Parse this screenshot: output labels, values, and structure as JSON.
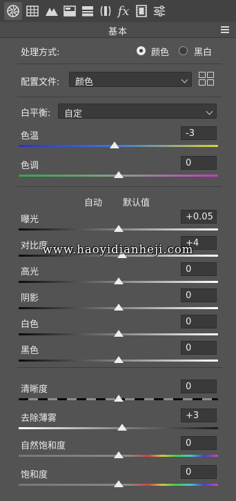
{
  "panel": {
    "title": "基本",
    "treatment_label": "处理方式:",
    "treatment_options": [
      "颜色",
      "黑白"
    ],
    "treatment_selected": "颜色",
    "profile_label": "配置文件:",
    "profile_value": "颜色",
    "white_balance_label": "白平衡:",
    "white_balance_value": "自定",
    "auto_label": "自动",
    "default_label": "默认值"
  },
  "toolbar": {
    "tools": [
      "basic-tool-icon",
      "tone-curve-grid-icon",
      "detail-mountain-icon",
      "hsl-split-icon",
      "split-toning-icon",
      "lens-corrections-icon",
      "fx-icon",
      "calibration-film-icon",
      "presets-sliders-icon"
    ],
    "fx_glyph": "fx"
  },
  "sliders": [
    {
      "label": "色温",
      "value": "-3",
      "position": 0.48
    },
    {
      "label": "色调",
      "value": "0",
      "position": 0.5
    },
    {
      "label": "曝光",
      "value": "+0.05",
      "position": 0.5
    },
    {
      "label": "对比度",
      "value": "+4",
      "position": 0.52
    },
    {
      "label": "高光",
      "value": "0",
      "position": 0.5
    },
    {
      "label": "阴影",
      "value": "0",
      "position": 0.5
    },
    {
      "label": "白色",
      "value": "0",
      "position": 0.5
    },
    {
      "label": "黑色",
      "value": "0",
      "position": 0.5
    },
    {
      "label": "清晰度",
      "value": "0",
      "position": 0.5
    },
    {
      "label": "去除薄雾",
      "value": "+3",
      "position": 0.52
    },
    {
      "label": "自然饱和度",
      "value": "0",
      "position": 0.5
    },
    {
      "label": "饱和度",
      "value": "0",
      "position": 0.5
    }
  ],
  "watermark": "www.haoyidianheji.com",
  "colors": {
    "panel_bg": "#535353",
    "field_bg": "#3a3a3a",
    "thumb": "#eeeeee"
  }
}
